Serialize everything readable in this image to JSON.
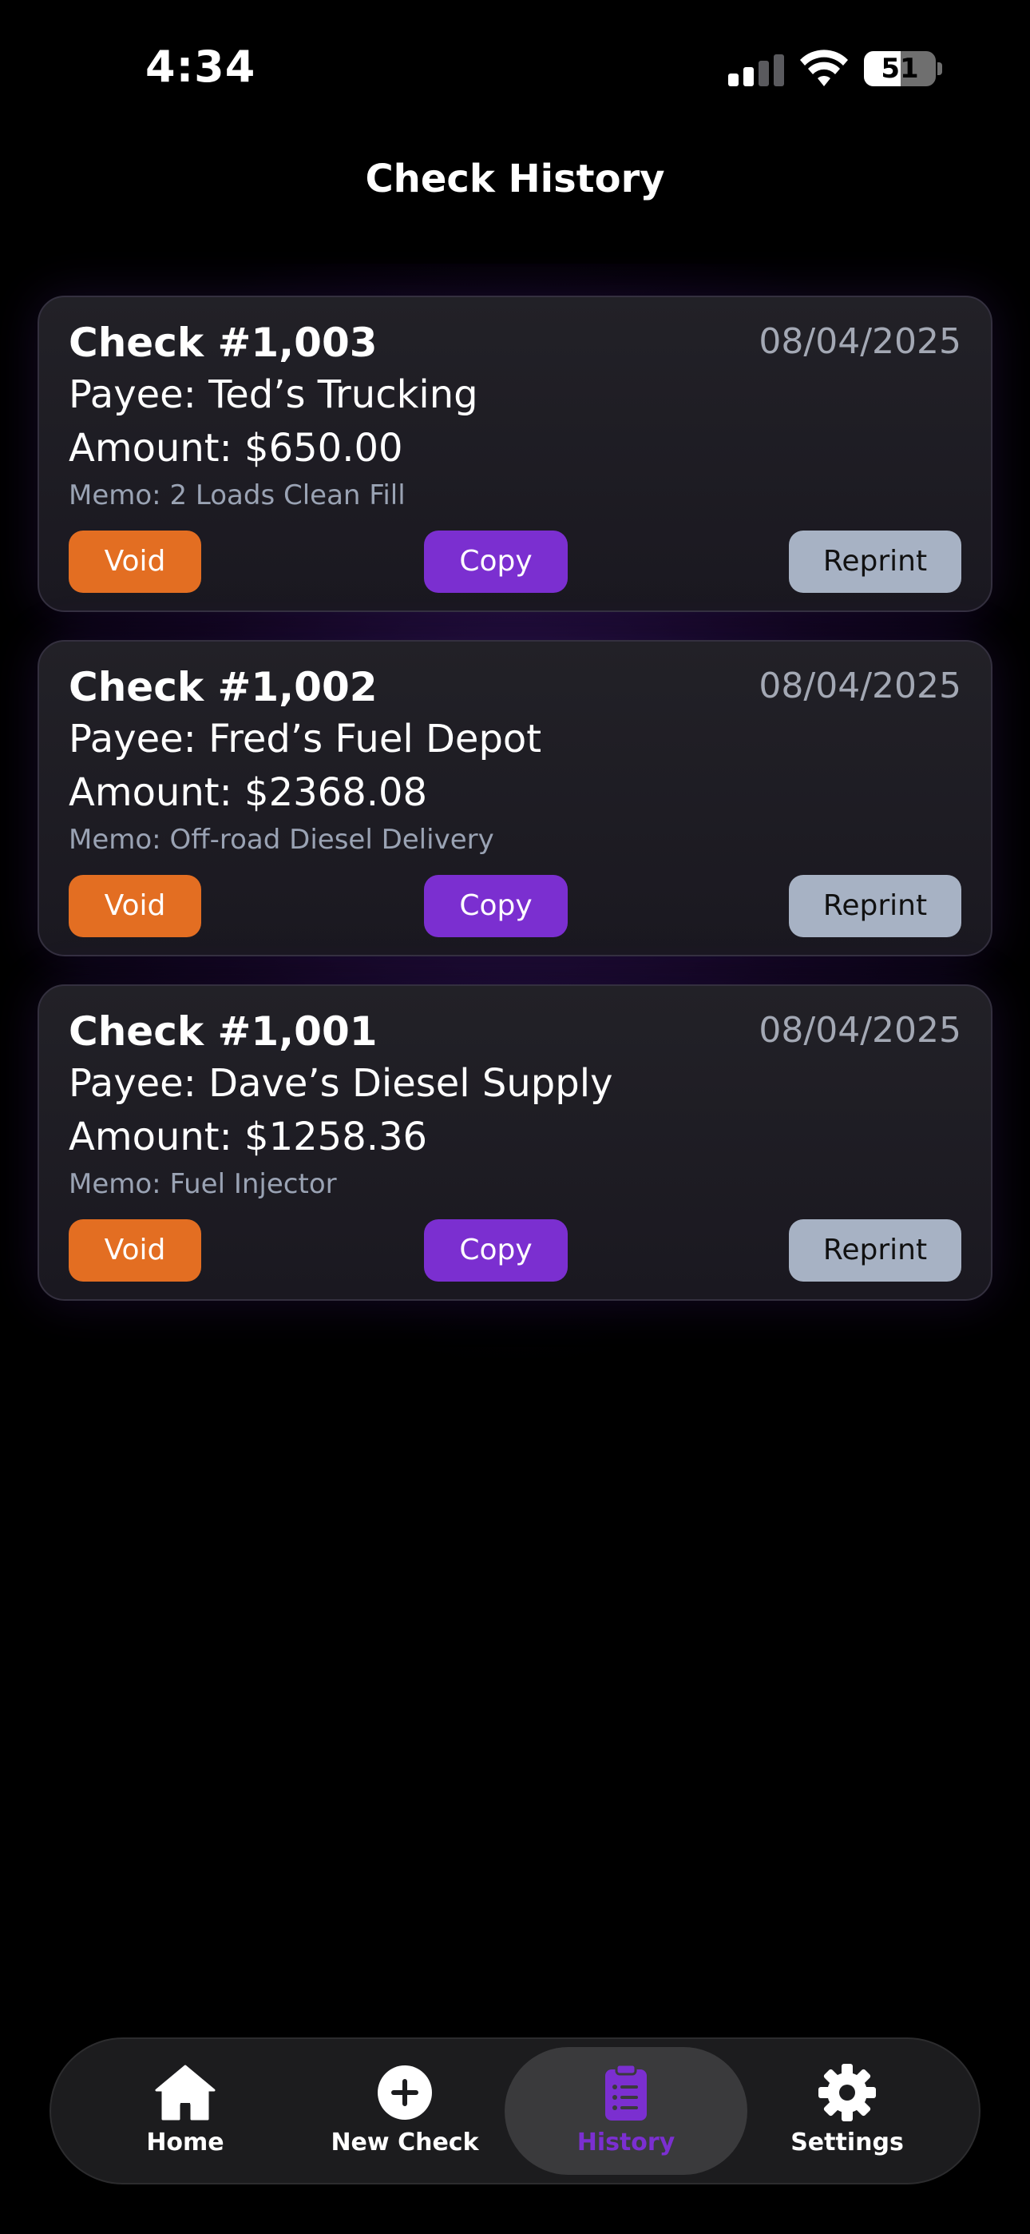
{
  "status_bar": {
    "time": "4:34",
    "battery_percent": "51",
    "battery_level": 0.51,
    "signal_bars_active": 2
  },
  "page": {
    "title": "Check History"
  },
  "colors": {
    "void": "#e36e22",
    "copy": "#7b2fd0",
    "reprint": "#a7b2c4",
    "accent": "#7b2fd0"
  },
  "checks": [
    {
      "number": "Check #1,003",
      "date": "08/04/2025",
      "payee": "Payee: Ted’s Trucking",
      "amount": "Amount: $650.00",
      "memo": "Memo: 2 Loads Clean Fill",
      "void_label": "Void",
      "copy_label": "Copy",
      "reprint_label": "Reprint"
    },
    {
      "number": "Check #1,002",
      "date": "08/04/2025",
      "payee": "Payee: Fred’s Fuel Depot",
      "amount": "Amount: $2368.08",
      "memo": "Memo: Off-road Diesel Delivery",
      "void_label": "Void",
      "copy_label": "Copy",
      "reprint_label": "Reprint"
    },
    {
      "number": "Check #1,001",
      "date": "08/04/2025",
      "payee": "Payee: Dave’s Diesel Supply",
      "amount": "Amount: $1258.36",
      "memo": "Memo: Fuel Injector",
      "void_label": "Void",
      "copy_label": "Copy",
      "reprint_label": "Reprint"
    }
  ],
  "tab_bar": {
    "tabs": [
      {
        "label": "Home",
        "icon": "house-icon"
      },
      {
        "label": "New Check",
        "icon": "plus-circle-icon"
      },
      {
        "label": "History",
        "icon": "clipboard-list-icon",
        "active": true
      },
      {
        "label": "Settings",
        "icon": "gear-icon"
      }
    ]
  }
}
